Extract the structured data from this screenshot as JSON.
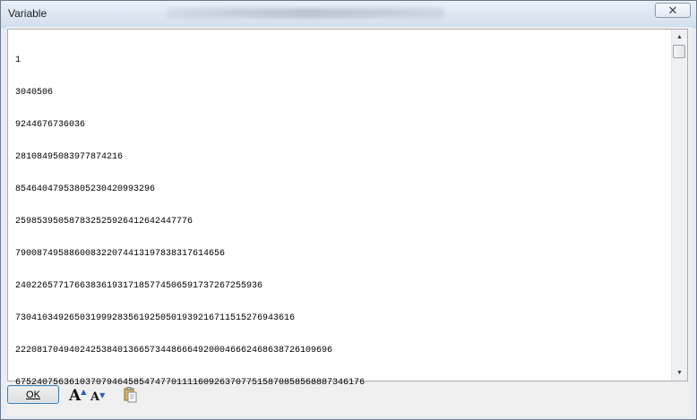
{
  "window": {
    "title": "Variable",
    "close_glyph": "✕"
  },
  "content": {
    "lines": [
      "1",
      "3040506",
      "9244676736036",
      "28108495083977874216",
      "854640479538052304209932​96",
      "25985395058783252592641264244 7776",
      "79008749588600832207441319783831​7614656",
      "24022657717663836193171857745065917372672 55936",
      "73041034926503199928356192505019392167115152769436 16",
      "222081704940242538401366573448666492000466624686387261 09696",
      "6752407563610370794645854747701111609263707751587085856888 7346176"
    ]
  },
  "scrollbar": {
    "up_glyph": "▲",
    "down_glyph": "▼"
  },
  "toolbar": {
    "ok_label": "OK",
    "font_larger_label": "A",
    "font_smaller_label": "A",
    "font_larger_icon": "font-increase-icon",
    "font_smaller_icon": "font-decrease-icon",
    "clipboard_icon": "clipboard-icon"
  }
}
